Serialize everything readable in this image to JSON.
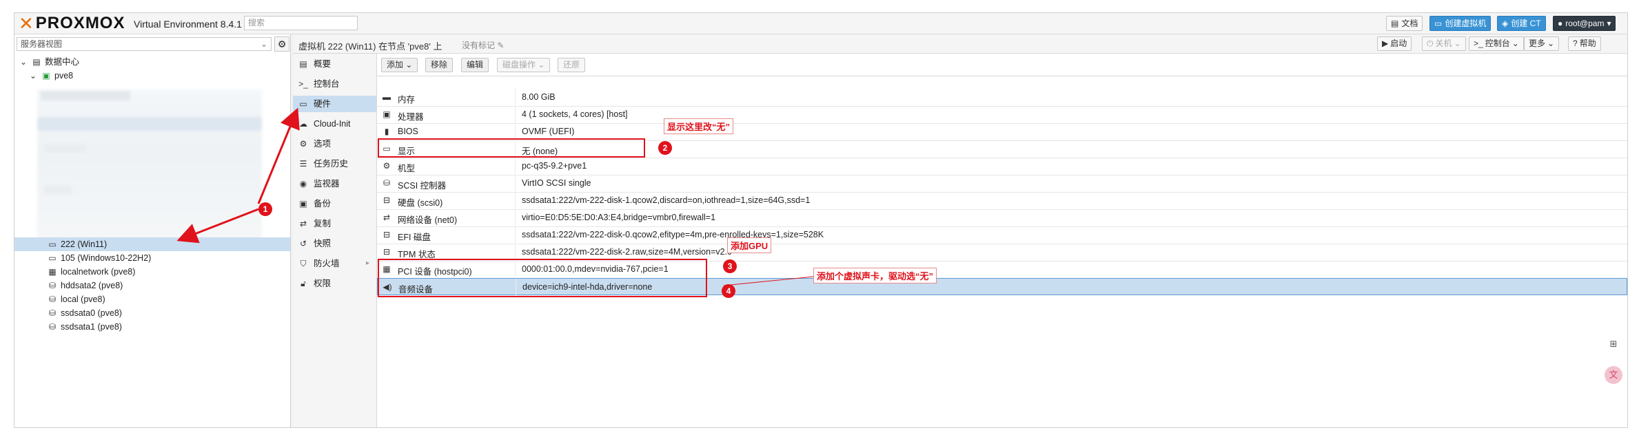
{
  "topbar": {
    "logo": "PROXMOX",
    "version": "Virtual Environment 8.4.1",
    "search_placeholder": "搜索",
    "docs": "文档",
    "create_vm": "创建虚拟机",
    "create_ct": "创建 CT",
    "user": "root@pam"
  },
  "tree": {
    "view": "服务器视图",
    "datacenter": "数据中心",
    "node": "pve8",
    "items": [
      {
        "label": "222 (Win11)"
      },
      {
        "label": "105 (Windows10-22H2)"
      },
      {
        "label": "localnetwork (pve8)"
      },
      {
        "label": "hddsata2 (pve8)"
      },
      {
        "label": "local (pve8)"
      },
      {
        "label": "ssdsata0 (pve8)"
      },
      {
        "label": "ssdsata1 (pve8)"
      }
    ]
  },
  "header": {
    "title": "虚拟机 222 (Win11) 在节点 'pve8' 上",
    "no_tags": "没有标记",
    "start": "启动",
    "shutdown": "关机",
    "console": "控制台",
    "more": "更多",
    "help": "帮助"
  },
  "nav": [
    {
      "label": "概要",
      "icon": "book-icon"
    },
    {
      "label": "控制台",
      "icon": "terminal-icon"
    },
    {
      "label": "硬件",
      "icon": "monitor-icon"
    },
    {
      "label": "Cloud-Init",
      "icon": "cloud-icon"
    },
    {
      "label": "选项",
      "icon": "gear-icon"
    },
    {
      "label": "任务历史",
      "icon": "list-icon"
    },
    {
      "label": "监视器",
      "icon": "eye-icon"
    },
    {
      "label": "备份",
      "icon": "floppy-icon"
    },
    {
      "label": "复制",
      "icon": "retweet-icon"
    },
    {
      "label": "快照",
      "icon": "history-icon"
    },
    {
      "label": "防火墙",
      "icon": "shield-icon"
    },
    {
      "label": "权限",
      "icon": "unlock-icon"
    }
  ],
  "hwtoolbar": {
    "add": "添加",
    "remove": "移除",
    "edit": "编辑",
    "disk_action": "磁盘操作",
    "revert": "还原"
  },
  "hardware": [
    {
      "key": "内存",
      "value": "8.00 GiB",
      "icon": "memory-icon"
    },
    {
      "key": "处理器",
      "value": "4 (1 sockets, 4 cores) [host]",
      "icon": "cpu-icon"
    },
    {
      "key": "BIOS",
      "value": "OVMF (UEFI)",
      "icon": "microchip-icon"
    },
    {
      "key": "显示",
      "value": "无 (none)",
      "icon": "desktop-icon"
    },
    {
      "key": "机型",
      "value": "pc-q35-9.2+pve1",
      "icon": "cogs-icon"
    },
    {
      "key": "SCSI 控制器",
      "value": "VirtIO SCSI single",
      "icon": "database-icon"
    },
    {
      "key": "硬盘 (scsi0)",
      "value": "ssdsata1:222/vm-222-disk-1.qcow2,discard=on,iothread=1,size=64G,ssd=1",
      "icon": "hdd-icon"
    },
    {
      "key": "网络设备 (net0)",
      "value": "virtio=E0:D5:5E:D0:A3:E4,bridge=vmbr0,firewall=1",
      "icon": "exchange-icon"
    },
    {
      "key": "EFI 磁盘",
      "value": "ssdsata1:222/vm-222-disk-0.qcow2,efitype=4m,pre-enrolled-keys=1,size=528K",
      "icon": "hdd-icon"
    },
    {
      "key": "TPM 状态",
      "value": "ssdsata1:222/vm-222-disk-2.raw,size=4M,version=v2.0",
      "icon": "hdd-icon"
    },
    {
      "key": "PCI 设备 (hostpci0)",
      "value": "0000:01:00.0,mdev=nvidia-767,pcie=1",
      "icon": "pci-icon"
    },
    {
      "key": "音频设备",
      "value": "device=ich9-intel-hda,driver=none",
      "icon": "volume-icon"
    }
  ],
  "annotations": {
    "n1": "1",
    "n2": "2",
    "n3": "3",
    "n4": "4",
    "note2": "显示这里改“无”",
    "note3": "添加GPU",
    "note4": "添加个虚拟声卡，驱动选“无”"
  },
  "colors": {
    "accent": "#e57000",
    "selection": "#c9ddf0",
    "annotation": "#e0121b"
  }
}
